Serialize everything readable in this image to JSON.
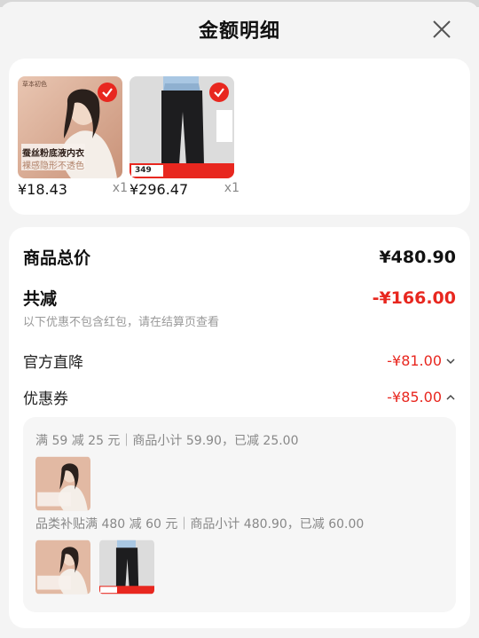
{
  "header": {
    "title": "金额明细"
  },
  "products": [
    {
      "price": "¥18.43",
      "qty": "x1",
      "banner_line1": "蚕丝粉底液内衣",
      "banner_line2": "裸感隐形不透色",
      "brand": "草本初色"
    },
    {
      "price": "¥296.47",
      "qty": "x1",
      "tag": "349"
    }
  ],
  "summary": {
    "total_label": "商品总价",
    "total_value": "¥480.90",
    "discount_label": "共减",
    "discount_value": "-¥166.00",
    "note": "以下优惠不包含红包，请在结算页查看",
    "official_label": "官方直降",
    "official_value": "-¥81.00",
    "coupon_label": "优惠券",
    "coupon_value": "-¥85.00"
  },
  "coupons": [
    {
      "text": "满 59 减 25 元｜商品小计 59.90，已减 25.00"
    },
    {
      "text": "品类补贴满 480 减 60 元｜商品小计 480.90，已减 60.00"
    }
  ],
  "colors": {
    "accent_red": "#e8271f",
    "card_bg": "#ffffff",
    "page_bg": "#f4f4f4"
  }
}
